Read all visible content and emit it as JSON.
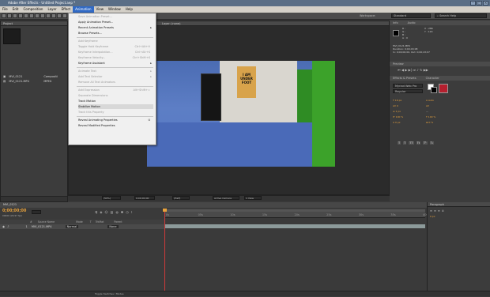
{
  "window": {
    "title": "Adobe After Effects - Untitled Project.aep *"
  },
  "menubar": [
    "File",
    "Edit",
    "Composition",
    "Layer",
    "Effect",
    "Animation",
    "View",
    "Window",
    "Help"
  ],
  "toolbar": {
    "workspace_label": "Workspace:",
    "workspace_value": "Standard",
    "search_placeholder": "Search Help"
  },
  "project": {
    "tab": "Project",
    "items": [
      {
        "name": "MVI_0121",
        "type": "Compositi"
      },
      {
        "name": "MVI_0121.MP4",
        "type": "MPEG"
      }
    ]
  },
  "animation_menu": {
    "items": [
      {
        "label": "Save Animation Preset...",
        "disabled": true
      },
      {
        "label": "Apply Animation Preset...",
        "disabled": false
      },
      {
        "label": "Recent Animation Presets",
        "disabled": false,
        "submenu": true
      },
      {
        "label": "Browse Presets...",
        "disabled": false
      },
      {
        "sep": true
      },
      {
        "label": "Add Keyframe",
        "disabled": true
      },
      {
        "label": "Toggle Hold Keyframe",
        "disabled": true,
        "shortcut": "Ctrl+Alt+H"
      },
      {
        "label": "Keyframe Interpolation...",
        "disabled": true,
        "shortcut": "Ctrl+Alt+K"
      },
      {
        "label": "Keyframe Velocity...",
        "disabled": true,
        "shortcut": "Ctrl+Shift+K"
      },
      {
        "label": "Keyframe Assistant",
        "disabled": false,
        "submenu": true
      },
      {
        "sep": true
      },
      {
        "label": "Animate Text",
        "disabled": true,
        "submenu": true
      },
      {
        "label": "Add Text Selector",
        "disabled": true,
        "submenu": true
      },
      {
        "label": "Remove All Text Animators",
        "disabled": true
      },
      {
        "sep": true
      },
      {
        "label": "Add Expression",
        "disabled": true,
        "shortcut": "Alt+Shift+="
      },
      {
        "label": "Separate Dimensions",
        "disabled": true
      },
      {
        "label": "Track Motion",
        "disabled": false
      },
      {
        "label": "Stabilize Motion",
        "disabled": false,
        "highlighted": true
      },
      {
        "label": "Track this Property",
        "disabled": true
      },
      {
        "sep": true
      },
      {
        "label": "Reveal Animating Properties",
        "disabled": false,
        "shortcut": "U"
      },
      {
        "label": "Reveal Modified Properties",
        "disabled": false
      }
    ]
  },
  "composition": {
    "tab": "Layer: (none)",
    "poster_text": "I AM UNDER FOOT",
    "zoom": "(50%)",
    "timecode": "0;00;00;00",
    "resolution": "(Half)",
    "camera": "Active Camera",
    "view": "1 View"
  },
  "info_panel": {
    "tabs": [
      "Info",
      "Audio"
    ],
    "r": "R :",
    "g": "G :",
    "b": "B :",
    "a": "A : 0",
    "x": "X : 286",
    "y": "Y : 124",
    "file": "MVI_0121.MP4",
    "duration": "Duration: 0;00;43;08",
    "inout": "In: 0;00;00;00, Out: 0;00;43;07"
  },
  "preview_panel": {
    "tab": "Preview"
  },
  "effects_panel": {
    "tabs": [
      "Effects & Presets",
      "Character"
    ]
  },
  "character_panel": {
    "font": "Myriad Web Pro",
    "style": "Regular",
    "size": "16 px",
    "leading": "Auto",
    "tracking": "0",
    "stroke": "1 px",
    "scale_v": "100 %",
    "scale_h": "100 %",
    "baseline": "0 px",
    "tsume": "0 %"
  },
  "timeline": {
    "tab": "MVI_0121",
    "timecode": "0;00;00;00",
    "frames": "00000 (29.97 fps)",
    "columns": [
      "#",
      "Source Name",
      "Mode",
      "T",
      "TrkMat",
      "Parent"
    ],
    "ruler_ticks": [
      "0s",
      "05s",
      "10s",
      "15s",
      "20s",
      "25s",
      "30s",
      "35s",
      "40s"
    ],
    "layer": {
      "index": "1",
      "name": "MVI_0121.MP4",
      "mode": "Normal",
      "parent": "None"
    },
    "bottom_label": "Toggle Switches / Modes"
  },
  "paragraph_panel": {
    "tab": "Paragraph",
    "indent": "0 px"
  },
  "colors": {
    "titlebar": "#5a6e86",
    "menu_active": "#316ac5",
    "timecode": "#e8a23c",
    "green_screen": "#3ca22a",
    "layer_bar": "#8c9a9a",
    "playhead": "#d13a3a"
  }
}
